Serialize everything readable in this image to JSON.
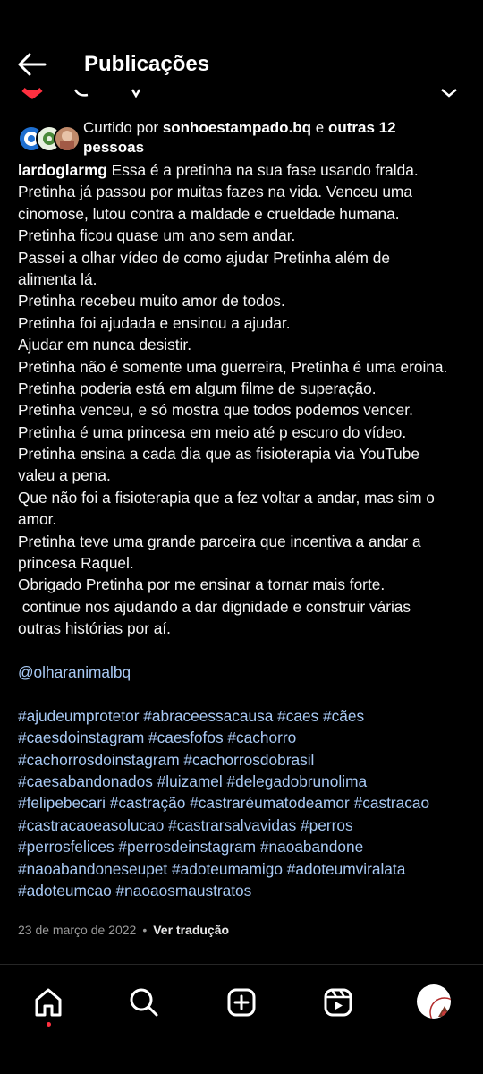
{
  "header": {
    "title": "Publicações",
    "back_icon": "arrow-left-icon"
  },
  "likes": {
    "prefix": "Curtido por ",
    "user": "sonhoestampado.bq",
    "middle": " e ",
    "others": "outras 12",
    "others_line2": "pessoas"
  },
  "caption": {
    "username": "lardoglarmg",
    "first_line_rest": " Essa é a pretinha na sua fase usando fralda.",
    "lines": [
      "Pretinha já passou por muitas fazes na vida. Venceu uma",
      "cinomose, lutou contra a maldade e crueldade humana.",
      "Pretinha ficou quase um ano sem andar.",
      "Passei a olhar vídeo de como ajudar Pretinha além de",
      "alimenta lá.",
      "Pretinha recebeu muito amor de todos.",
      "Pretinha foi ajudada e ensinou a ajudar.",
      "Ajudar em nunca desistir.",
      "Pretinha não é somente uma guerreira, Pretinha é uma eroina.",
      "Pretinha poderia está em algum filme de superação.",
      "Pretinha venceu, e só mostra que todos podemos vencer.",
      "Pretinha é uma princesa em meio até p escuro do vídeo.",
      "Pretinha ensina a cada dia que as fisioterapia via YouTube",
      "valeu a pena.",
      "Que não foi a fisioterapia que a fez voltar a andar, mas sim o",
      "amor.",
      "Pretinha teve uma grande parceira que incentiva a andar a",
      "princesa Raquel.",
      "Obrigado Pretinha por me ensinar a tornar mais forte.",
      " continue nos ajudando a dar dignidade e construir várias",
      "outras histórias por aí."
    ],
    "mention": "@olharanimalbq",
    "hashtag_lines": [
      "#ajudeumprotetor #abraceessacausa #caes #cães",
      "#caesdoinstagram #caesfofos #cachorro",
      "#cachorrosdoinstagram #cachorrosdobrasil",
      "#caesabandonados #luizamel #delegadobrunolima",
      "#felipebecari #castração #castraréumatodeamor #castracao",
      "#castracaoeasolucao #castrarsalvavidas #perros",
      "#perrosfelices #perrosdeinstagram #naoabandone",
      "#naoabandoneseupet #adoteumamigo #adoteumviralata",
      "#adoteumcao #naoaosmaustratos"
    ]
  },
  "meta": {
    "date": "23 de março de 2022",
    "separator": "•",
    "translate": "Ver tradução"
  },
  "nav": {
    "items": [
      "home-icon",
      "search-icon",
      "create-post-icon",
      "reels-icon",
      "profile-avatar"
    ]
  },
  "colors": {
    "background": "#000000",
    "text": "#f5f5f5",
    "link": "#a8c9f4",
    "muted": "#9a9a9a",
    "notification": "#ff3040"
  }
}
